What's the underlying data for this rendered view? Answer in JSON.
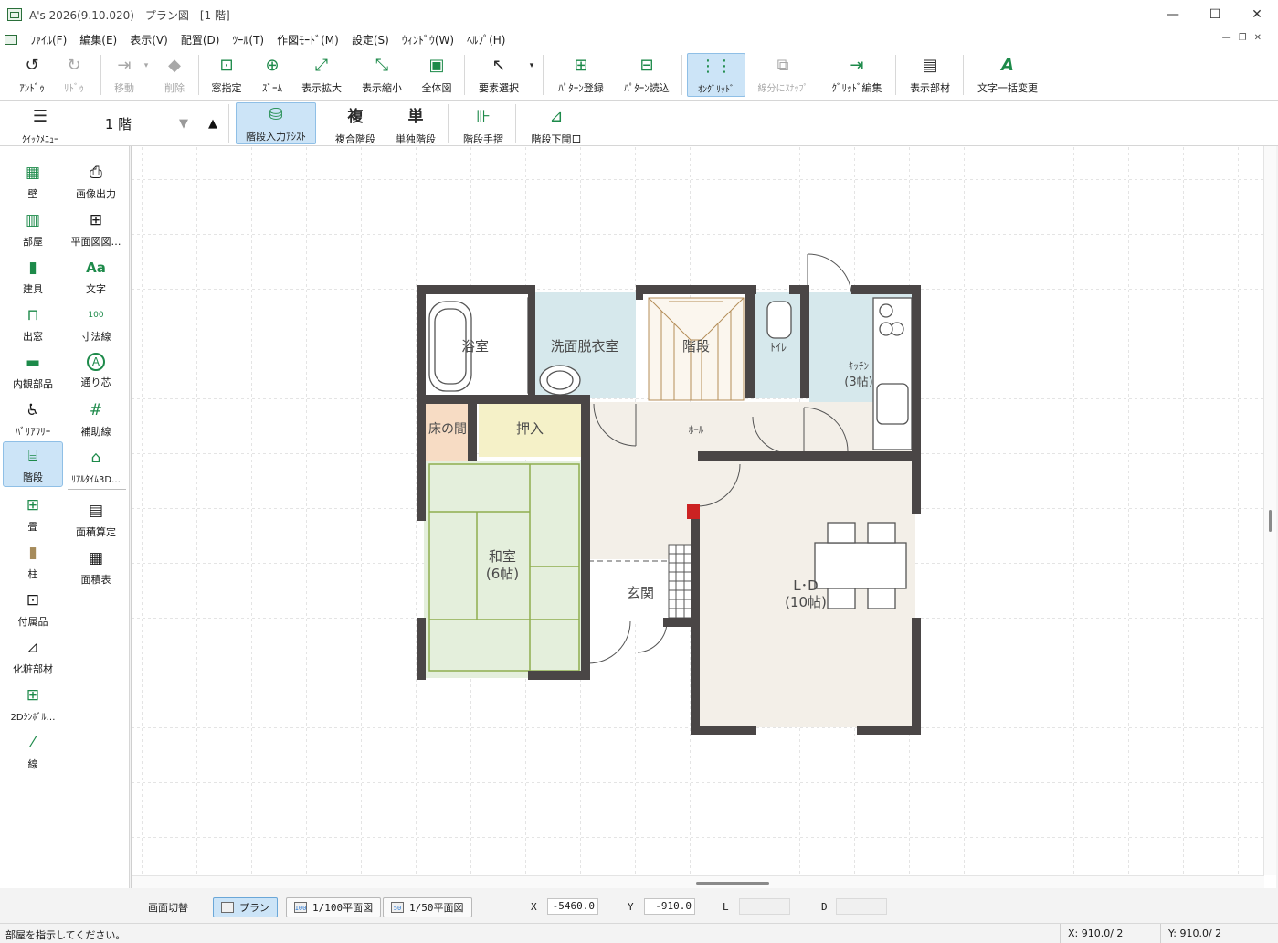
{
  "window": {
    "title": "A's 2026(9.10.020) - プラン図 - [1 階]",
    "minimize": "—",
    "maximize": "☐",
    "close": "✕"
  },
  "menu": [
    {
      "label": "ﾌｧｲﾙ(F)"
    },
    {
      "label": "編集(E)"
    },
    {
      "label": "表示(V)"
    },
    {
      "label": "配置(D)"
    },
    {
      "label": "ﾂｰﾙ(T)"
    },
    {
      "label": "作図ﾓｰﾄﾞ(M)"
    },
    {
      "label": "設定(S)"
    },
    {
      "label": "ｳｨﾝﾄﾞｳ(W)"
    },
    {
      "label": "ﾍﾙﾌﾟ(H)"
    }
  ],
  "toolbar1": {
    "undo": "ｱﾝﾄﾞｩ",
    "redo": "ﾘﾄﾞｩ",
    "move": "移動",
    "delete": "削除",
    "window_zoom": "窓指定",
    "zoom": "ｽﾞｰﾑ",
    "zoom_in": "表示拡大",
    "zoom_out": "表示縮小",
    "fit": "全体図",
    "select": "要素選択",
    "pattern_save": "ﾊﾟﾀｰﾝ登録",
    "pattern_load": "ﾊﾟﾀｰﾝ読込",
    "on_grid": "ｵﾝｸﾞﾘｯﾄﾞ",
    "snap_segment": "線分にｽﾅｯﾌﾟ",
    "grid_edit": "ｸﾞﾘｯﾄﾞ編集",
    "show_parts": "表示部材",
    "text_replace": "文字一括変更"
  },
  "toolbar2": {
    "quick_menu": "ｸｲｯｸﾒﾆｭｰ",
    "floor": "1 階",
    "stair_assist": "階段入力ｱｼｽﾄ",
    "compound_stair_icon": "複",
    "compound_stair": "複合階段",
    "single_stair_icon": "単",
    "single_stair": "単独階段",
    "stair_rail": "階段手摺",
    "stair_opening": "階段下開口"
  },
  "palette": [
    {
      "label": "壁"
    },
    {
      "label": "画像出力"
    },
    {
      "label": "部屋"
    },
    {
      "label": "平面図図…"
    },
    {
      "label": "建具"
    },
    {
      "label": "文字"
    },
    {
      "label": "出窓"
    },
    {
      "label": "寸法線"
    },
    {
      "label": "内観部品"
    },
    {
      "label": "通り芯"
    },
    {
      "label": "ﾊﾞﾘｱﾌﾘｰ"
    },
    {
      "label": "補助線"
    },
    {
      "label": "階段"
    },
    {
      "label": "ﾘｱﾙﾀｲﾑ3D…"
    },
    {
      "label": "畳"
    },
    {
      "label": "面積算定"
    },
    {
      "label": "柱"
    },
    {
      "label": "面積表"
    },
    {
      "label": "付属品"
    },
    {
      "label": "化粧部材"
    },
    {
      "label": "2Dｼﾝﾎﾞﾙ…"
    },
    {
      "label": "線"
    }
  ],
  "palette_icons": {
    "text": "Aa",
    "dimension": "100",
    "axis": "A"
  },
  "floorplan": {
    "rooms": {
      "bath": "浴室",
      "washroom": "洗面脱衣室",
      "stairs": "階段",
      "toilet": "ﾄｲﾚ",
      "kitchen": "ｷｯﾁﾝ",
      "kitchen_size": "(3帖)",
      "tokonoma": "床の間",
      "closet": "押入",
      "hall": "ﾎｰﾙ",
      "washitsu": "和室",
      "washitsu_size": "(6帖)",
      "entrance": "玄関",
      "ld": "L･D",
      "ld_size": "(10帖)"
    },
    "colors": {
      "wall": "#4a4646",
      "washroom": "#d6e8ec",
      "tatami": "#e4efdc",
      "tokonoma": "#f7dcc4",
      "closet": "#f5f1c8",
      "floor": "#f3efe8"
    }
  },
  "viewbar": {
    "switch": "画面切替",
    "plan": "プラン",
    "plan100": "1/100平面図",
    "plan50": "1/50平面図",
    "plan100_icon": "100",
    "plan50_icon": "50",
    "x_label": "X",
    "x_value": "-5460.0",
    "y_label": "Y",
    "y_value": "-910.0",
    "l_label": "L",
    "d_label": "D"
  },
  "status": {
    "message": "部屋を指示してください。",
    "x": "X: 910.0/ 2",
    "y": "Y: 910.0/ 2"
  }
}
